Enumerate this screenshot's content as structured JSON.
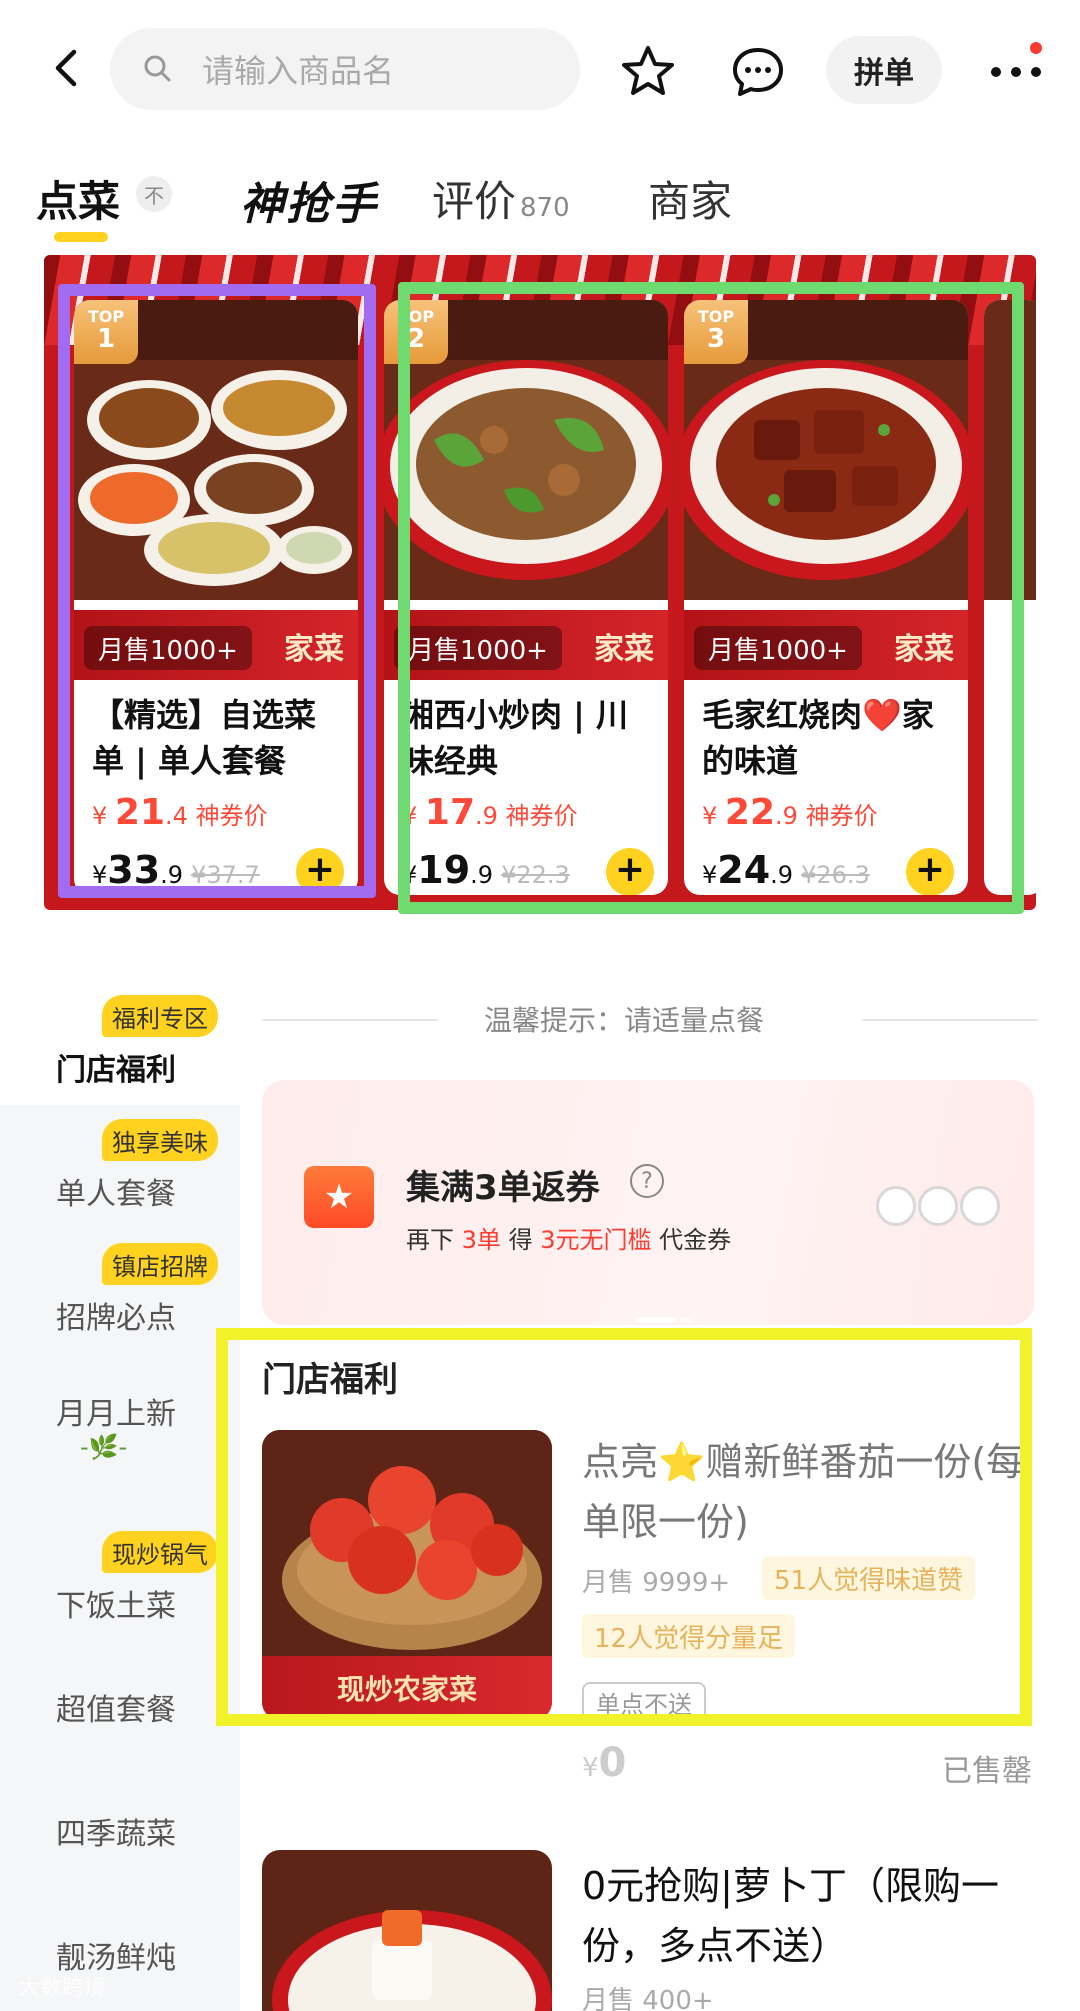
{
  "topbar": {
    "search_placeholder": "请输入商品名",
    "pindan_label": "拼单",
    "icons": [
      "back-arrow-icon",
      "search-icon",
      "star-icon",
      "chat-icon",
      "more-icon"
    ]
  },
  "tabs": {
    "order": "点菜",
    "pin": "不",
    "grab": "神抢手",
    "review": "评价",
    "review_count": "870",
    "shop": "商家"
  },
  "banner": {
    "cards": [
      {
        "rank_top": "TOP",
        "rank": "1",
        "sold": "月售1000+",
        "strip_text": "家菜",
        "name": "【精选】自选菜单 | 单人套餐",
        "coupon_prefix": "¥",
        "coupon_int": "21",
        "coupon_dec": ".4",
        "coupon_label": "神券价",
        "price_prefix": "¥",
        "price_int": "33",
        "price_dec": ".9",
        "orig": "¥37.7",
        "add": "+"
      },
      {
        "rank_top": "TOP",
        "rank": "2",
        "sold": "月售1000+",
        "strip_text": "家菜",
        "name": "湘西小炒肉 | 川味经典",
        "coupon_prefix": "¥",
        "coupon_int": "17",
        "coupon_dec": ".9",
        "coupon_label": "神券价",
        "price_prefix": "¥",
        "price_int": "19",
        "price_dec": ".9",
        "orig": "¥22.3",
        "add": "+"
      },
      {
        "rank_top": "TOP",
        "rank": "3",
        "sold": "月售1000+",
        "strip_text": "家菜",
        "name": "毛家红烧肉❤️家的味道",
        "coupon_prefix": "¥",
        "coupon_int": "22",
        "coupon_dec": ".9",
        "coupon_label": "神券价",
        "price_prefix": "¥",
        "price_int": "24",
        "price_dec": ".9",
        "orig": "¥26.3",
        "add": "+"
      }
    ]
  },
  "sidebar": {
    "items": [
      {
        "label": "门店福利",
        "tag": "福利专区"
      },
      {
        "label": "单人套餐",
        "tag": "独享美味"
      },
      {
        "label": "招牌必点",
        "tag": "镇店招牌"
      },
      {
        "label": "月月上新",
        "leaf": "-🌿-"
      },
      {
        "label": "下饭土菜",
        "tag": "现炒锅气"
      },
      {
        "label": "超值套餐"
      },
      {
        "label": "四季蔬菜"
      },
      {
        "label": "靓汤鲜炖"
      }
    ]
  },
  "tip": "温馨提示：请适量点餐",
  "coupon": {
    "title": "集满3单返券",
    "q": "?",
    "sub_a": "再下",
    "sub_b": "3单",
    "sub_c": "得",
    "sub_d": "3元无门槛",
    "sub_e": "代金券"
  },
  "section": {
    "title": "门店福利"
  },
  "item1": {
    "name": "点亮⭐赠新鲜番茄一份(每单限一份)",
    "sales": "月售 9999+",
    "tag1": "51人觉得味道赞",
    "tag2": "12人觉得分量足",
    "nosend": "单点不送",
    "price_prefix": "¥",
    "price": "0",
    "soldout": "已售罄",
    "strip": "现炒农家菜"
  },
  "item2": {
    "name": "0元抢购|萝卜丁（限购一份，多点不送）",
    "sales": "月售 400+"
  },
  "watermark": "大数跨境"
}
